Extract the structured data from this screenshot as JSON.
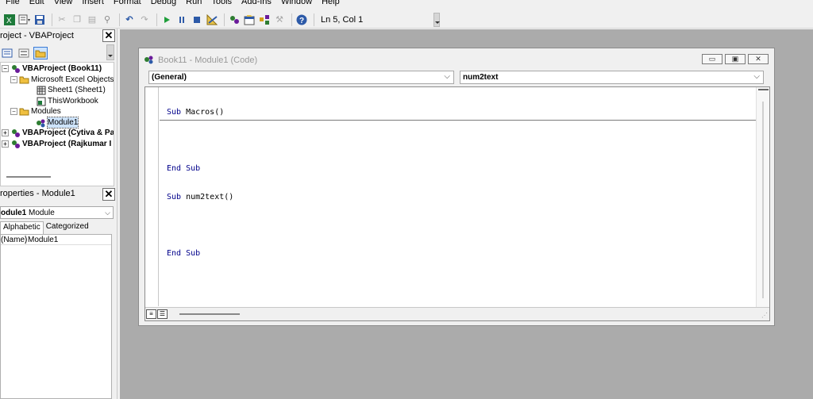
{
  "menu": [
    "File",
    "Edit",
    "View",
    "Insert",
    "Format",
    "Debug",
    "Run",
    "Tools",
    "Add-Ins",
    "Window",
    "Help"
  ],
  "toolbar": {
    "status": "Ln 5, Col 1",
    "icons": [
      "excel-icon",
      "insert-module-icon",
      "save-icon",
      "cut-icon",
      "copy-icon",
      "paste-icon",
      "find-icon",
      "undo-icon",
      "redo-icon",
      "run-icon",
      "break-icon",
      "reset-icon",
      "design-mode-icon",
      "project-explorer-icon",
      "properties-icon",
      "object-browser-icon",
      "toolbox-icon",
      "help-icon"
    ]
  },
  "project_pane": {
    "title": "roject - VBAProject",
    "tree": [
      {
        "label": "VBAProject (Book11)",
        "level": 0,
        "bold": true
      },
      {
        "label": "Microsoft Excel Objects",
        "level": 1
      },
      {
        "label": "Sheet1 (Sheet1)",
        "level": 2
      },
      {
        "label": "ThisWorkbook",
        "level": 2
      },
      {
        "label": "Modules",
        "level": 1
      },
      {
        "label": "Module1",
        "level": 2,
        "selected": true
      },
      {
        "label": "VBAProject (Cytiva & Pa",
        "level": 0,
        "bold": true
      },
      {
        "label": "VBAProject (Rajkumar I",
        "level": 0,
        "bold": true
      }
    ]
  },
  "properties_pane": {
    "title": "roperties - Module1",
    "object_name": "odule1",
    "object_type": "Module",
    "tabs": [
      "Alphabetic",
      "Categorized"
    ],
    "rows": [
      {
        "key": "(Name)",
        "value": "Module1"
      }
    ]
  },
  "code_window": {
    "title": "Book11 - Module1 (Code)",
    "object_combo": "(General)",
    "procedure_combo": "num2text",
    "lines": [
      {
        "kw": "Sub",
        "rest": " Macros()"
      },
      {
        "kw": "",
        "rest": ""
      },
      {
        "kw": "End Sub",
        "rest": ""
      },
      {
        "kw": "Sub",
        "rest": " num2text()"
      },
      {
        "kw": "",
        "rest": ""
      },
      {
        "kw": "End Sub",
        "rest": ""
      }
    ]
  }
}
